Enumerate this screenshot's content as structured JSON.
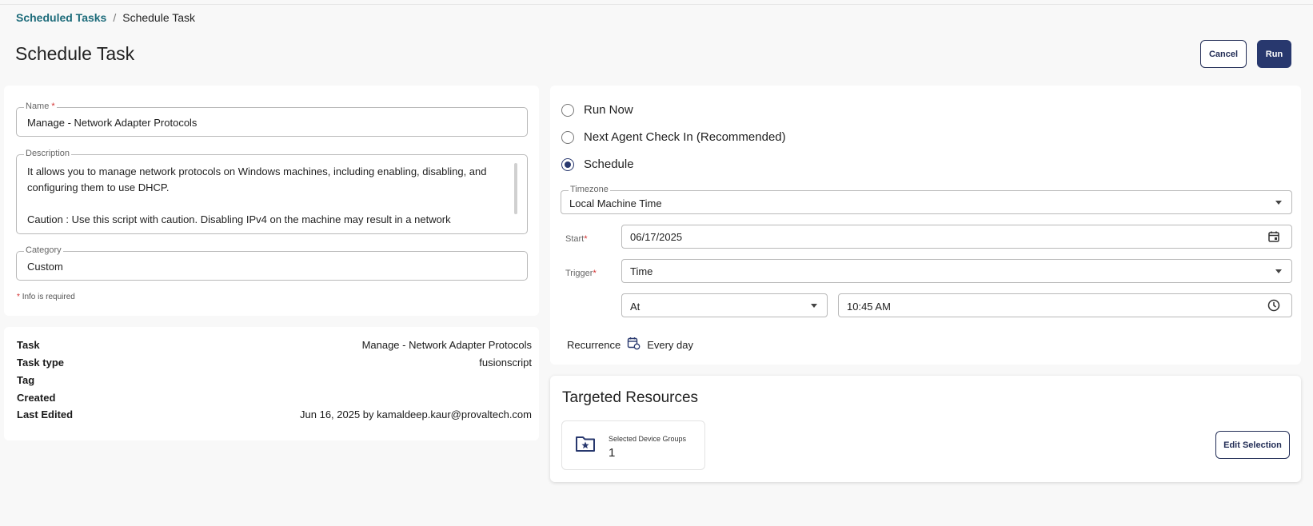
{
  "breadcrumb": {
    "parent": "Scheduled Tasks",
    "separator": "/",
    "current": "Schedule Task"
  },
  "page_title": "Schedule Task",
  "actions": {
    "cancel_label": "Cancel",
    "run_label": "Run"
  },
  "form": {
    "name": {
      "label": "Name",
      "required_mark": "*",
      "value": "Manage - Network Adapter Protocols"
    },
    "description": {
      "label": "Description",
      "value": "It allows you to manage network protocols on Windows machines, including enabling, disabling, and configuring them to use DHCP.\n\nCaution : Use this script with caution. Disabling IPv4 on the machine may result in a network"
    },
    "category": {
      "label": "Category",
      "value": "Custom"
    },
    "required_note_star": "*",
    "required_note": "Info is required"
  },
  "info": {
    "rows": [
      {
        "key": "Task",
        "value": "Manage - Network Adapter Protocols"
      },
      {
        "key": "Task type",
        "value": "fusionscript"
      },
      {
        "key": "Tag",
        "value": ""
      },
      {
        "key": "Created",
        "value": ""
      },
      {
        "key": "Last Edited",
        "value": "Jun 16, 2025 by kamaldeep.kaur@provaltech.com"
      }
    ]
  },
  "schedule": {
    "options": [
      {
        "label": "Run Now",
        "selected": false
      },
      {
        "label": "Next Agent Check In (Recommended)",
        "selected": false
      },
      {
        "label": "Schedule",
        "selected": true
      }
    ],
    "timezone": {
      "label": "Timezone",
      "value": "Local Machine Time"
    },
    "start": {
      "label": "Start",
      "required_mark": "*",
      "value": "06/17/2025"
    },
    "trigger": {
      "label": "Trigger",
      "required_mark": "*",
      "value": "Time"
    },
    "at": {
      "value": "At"
    },
    "time": {
      "value": "10:45 AM"
    },
    "recurrence": {
      "label": "Recurrence",
      "value": "Every day"
    }
  },
  "targets": {
    "title": "Targeted Resources",
    "device_groups_label": "Selected Device Groups",
    "device_groups_count": "1",
    "edit_label": "Edit Selection"
  },
  "colors": {
    "primary": "#28386e",
    "link": "#1c6b7a",
    "required": "#d32f2f"
  },
  "icons": [
    "calendar-icon",
    "dropdown-caret-icon",
    "clock-icon",
    "recurrence-calendar-icon",
    "folder-star-icon"
  ]
}
